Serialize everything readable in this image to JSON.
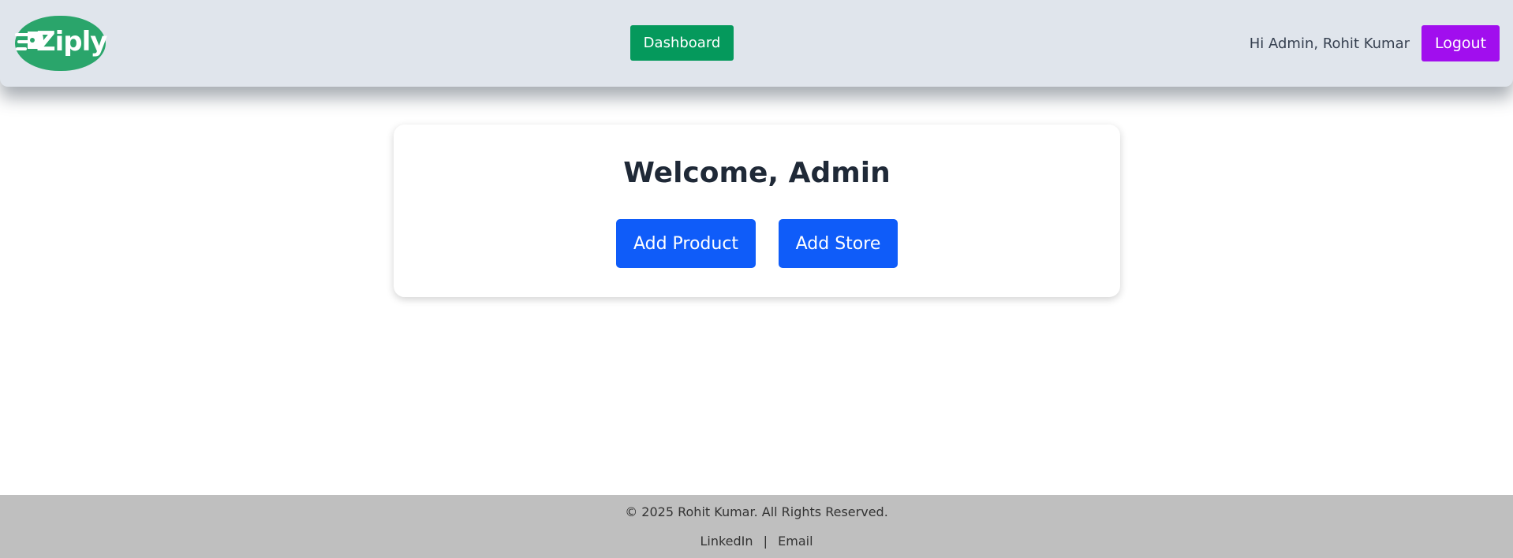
{
  "header": {
    "logo_text": "Ziply",
    "dashboard_label": "Dashboard",
    "greeting": "Hi Admin, Rohit Kumar",
    "logout_label": "Logout"
  },
  "main": {
    "title": "Welcome, Admin",
    "add_product_label": "Add Product",
    "add_store_label": "Add Store"
  },
  "footer": {
    "copyright": "© 2025 Rohit Kumar. All Rights Reserved.",
    "links": [
      "LinkedIn",
      "Email"
    ],
    "separator": "|"
  },
  "colors": {
    "header_bg": "#e0e5ec",
    "logo_green": "#2aa56b",
    "dashboard_button": "#05995c",
    "logout_button": "#a10eee",
    "primary_button": "#0f5cf9",
    "footer_bg": "#bfbfbf"
  },
  "icons": {
    "logo": "ziply-logo-icon"
  }
}
